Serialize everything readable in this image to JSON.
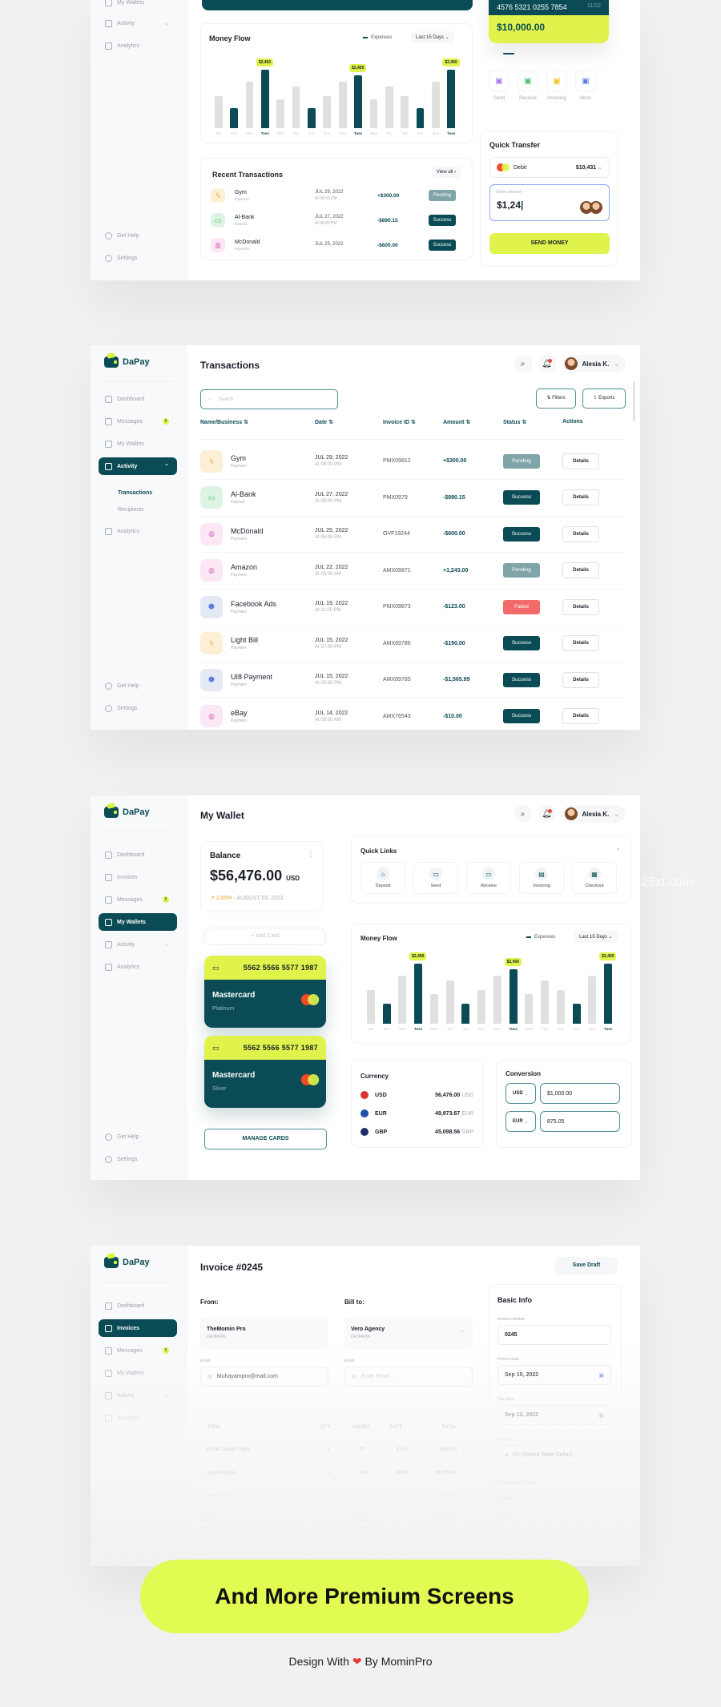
{
  "brand": {
    "name": "DaPay",
    "primary": "#0a4b55",
    "accent": "#dff34c",
    "danger": "#f26a6a"
  },
  "user": {
    "name": "Alesia K."
  },
  "screen1": {
    "sidebar": {
      "items": [
        {
          "label": "My Wallets"
        },
        {
          "label": "Activity"
        },
        {
          "label": "Analytics"
        }
      ],
      "footer": [
        {
          "label": "Get Help"
        },
        {
          "label": "Settings"
        }
      ]
    },
    "card": {
      "number": "4576 5321 0255 7854",
      "expiry": "11/22",
      "balance": "$10,000.00"
    },
    "actions": [
      {
        "label": "Send"
      },
      {
        "label": "Receive"
      },
      {
        "label": "Invoicing"
      },
      {
        "label": "More"
      }
    ],
    "money_flow": {
      "title": "Money Flow",
      "legend": "Expenses",
      "range": "Last 15 Days"
    },
    "quick_transfer": {
      "title": "Quick Transfer",
      "source": "Debit",
      "source_balance": "$10,431",
      "amount_label": "Enter amount",
      "amount_value": "$1,24",
      "send_label": "SEND MONEY"
    },
    "recent": {
      "title": "Recent Transactions",
      "view_all": "View all",
      "rows": [
        {
          "name": "Gym",
          "type": "Payment",
          "date": "JUL 29, 2022",
          "time": "At 08:00 PM",
          "amount": "+$300.00",
          "status": "Pending"
        },
        {
          "name": "Al-Bank",
          "type": "Deposit",
          "date": "JUL 27, 2022",
          "time": "At 09:00 PM",
          "amount": "-$890.15",
          "status": "Success"
        },
        {
          "name": "McDonald",
          "type": "Payment",
          "date": "JUL 25, 2022",
          "time": "",
          "amount": "-$600.00",
          "status": "Success"
        }
      ]
    }
  },
  "screen2": {
    "title": "Transactions",
    "sidebar": {
      "items": [
        {
          "label": "Dashboard"
        },
        {
          "label": "Messages",
          "badge": "5"
        },
        {
          "label": "My Wallets"
        },
        {
          "label": "Activity"
        },
        {
          "label": "Analytics"
        }
      ],
      "sub": [
        {
          "label": "Transactions"
        },
        {
          "label": "Recipients"
        }
      ],
      "footer": [
        {
          "label": "Get Help"
        },
        {
          "label": "Settings"
        }
      ]
    },
    "search_placeholder": "Search",
    "filters_label": "Filters",
    "exports_label": "Exports",
    "columns": [
      "Name/Business",
      "Date",
      "Invoice ID",
      "Amount",
      "Status",
      "Actions"
    ],
    "details_label": "Details",
    "rows": [
      {
        "name": "Gym",
        "type": "Payment",
        "date": "JUL 29, 2022",
        "time": "At 08:00 PM",
        "invoice": "PMX09812",
        "amount": "+$300.00",
        "status": "Pending",
        "icon": "bolt"
      },
      {
        "name": "Al-Bank",
        "type": "Deposit",
        "date": "JUL 27, 2022",
        "time": "At 09:00 PM",
        "invoice": "PMX0979",
        "amount": "-$890.15",
        "status": "Success",
        "icon": "cash"
      },
      {
        "name": "McDonald",
        "type": "Payment",
        "date": "JUL 25, 2022",
        "time": "At 05:00 PM",
        "invoice": "OVF19244",
        "amount": "-$600.00",
        "status": "Success",
        "icon": "bag"
      },
      {
        "name": "Amazon",
        "type": "Payment",
        "date": "JUL 22, 2022",
        "time": "At 08:00 AM",
        "invoice": "AMX09871",
        "amount": "+1,243.00",
        "status": "Pending",
        "icon": "bag"
      },
      {
        "name": "Facebook Ads",
        "type": "Payment",
        "date": "JUL 19, 2022",
        "time": "At 11:00 PM",
        "invoice": "PMX09873",
        "amount": "-$123.00",
        "status": "Failed",
        "icon": "hex"
      },
      {
        "name": "Light Bill",
        "type": "Payment",
        "date": "JUL 15, 2022",
        "time": "At 07:00 PM",
        "invoice": "AMX89786",
        "amount": "-$190.00",
        "status": "Success",
        "icon": "bolt"
      },
      {
        "name": "UI8 Payment",
        "type": "Payment",
        "date": "JUL 15, 2022",
        "time": "At 05:00 PM",
        "invoice": "AMX89785",
        "amount": "-$1,565.99",
        "status": "Success",
        "icon": "hex"
      },
      {
        "name": "eBay",
        "type": "Payment",
        "date": "JUL 14, 2022",
        "time": "At 09:00 AM",
        "invoice": "AMX76543",
        "amount": "-$10.00",
        "status": "Success",
        "icon": "bag"
      }
    ]
  },
  "screen3": {
    "title": "My Wallet",
    "sidebar": {
      "items": [
        {
          "label": "Dashboard"
        },
        {
          "label": "Invoices"
        },
        {
          "label": "Messages",
          "badge": "5"
        },
        {
          "label": "My Wallets"
        },
        {
          "label": "Activity"
        },
        {
          "label": "Analytics"
        }
      ],
      "footer": [
        {
          "label": "Get Help"
        },
        {
          "label": "Settings"
        }
      ]
    },
    "balance": {
      "title": "Balance",
      "amount": "$56,476.00",
      "currency": "USD",
      "change": "2.05%",
      "date": "AUGUST 03, 2022"
    },
    "add_card": "+ Add Card",
    "cards": [
      {
        "number": "5562 5566 5577 1987",
        "brand": "Mastercard",
        "tier": "Platinum"
      },
      {
        "number": "5562 5566 5577 1987",
        "brand": "Mastercard",
        "tier": "Silver"
      }
    ],
    "manage_cards": "MANAGE CARDS",
    "quick_links": {
      "title": "Quick Links",
      "items": [
        {
          "label": "Deposit"
        },
        {
          "label": "Send"
        },
        {
          "label": "Receive"
        },
        {
          "label": "Invoicing"
        },
        {
          "label": "Checkout"
        }
      ]
    },
    "money_flow": {
      "title": "Money Flow",
      "legend": "Expenses",
      "range": "Last 15 Days"
    },
    "currency": {
      "title": "Currency",
      "rows": [
        {
          "code": "USD",
          "amount": "56,476.00",
          "unit": "USD"
        },
        {
          "code": "EUR",
          "amount": "49,973.67",
          "unit": "EUR"
        },
        {
          "code": "GBP",
          "amount": "45,098.56",
          "unit": "GBP"
        }
      ]
    },
    "conversion": {
      "title": "Conversion",
      "from_currency": "USD",
      "from_amount": "$1,000.00",
      "to_currency": "EUR",
      "to_amount": "875.05"
    }
  },
  "screen4": {
    "title": "Invoice #0245",
    "save_draft": "Save Draft",
    "sidebar": {
      "items": [
        {
          "label": "Dashboard"
        },
        {
          "label": "Invoices"
        },
        {
          "label": "Messages",
          "badge": "5"
        },
        {
          "label": "My Wallets"
        },
        {
          "label": "Activity"
        },
        {
          "label": "Analytics"
        }
      ]
    },
    "from": {
      "label": "From:",
      "name": "TheMomin Pro",
      "id": "DA784166",
      "email_label": "Email",
      "email": "Muhayampro@mail.com"
    },
    "bill_to": {
      "label": "Bill to:",
      "name": "Vero Agency",
      "id": "DA784166",
      "email_label": "Email",
      "email_placeholder": "Enter Email ..."
    },
    "items": {
      "columns": [
        "ITEM",
        "QTY",
        "HOURS",
        "RATE",
        "TOTAL"
      ],
      "rows": [
        {
          "item": "Poster Design Prject",
          "qty": "1",
          "hours": "20",
          "rate": "$2.00",
          "total": "$500.00"
        },
        {
          "item": "Logo Designs",
          "qty": "5",
          "hours": "140",
          "rate": "$9.00",
          "total": "$8,789.00"
        },
        {
          "item": "Description",
          "qty": "0",
          "hours": "0",
          "rate": "0",
          "total": "$0.00"
        }
      ],
      "add_item": "Add Item",
      "subtotal_label": "Subtotal",
      "subtotal": "$8,856.00"
    },
    "basic_info": {
      "title": "Basic Info",
      "invoice_number_label": "Invoice number",
      "invoice_number": "0245",
      "invoice_date_label": "Invoice date",
      "invoice_date": "Sep 10, 2022",
      "due_date_label": "Due date",
      "due_date": "Sep 12, 2022",
      "currency_label": "Currency",
      "currency": "US (United State Dollar)",
      "payment_method": "Payment method",
      "late_fees": "Late fees",
      "notes": "Notes"
    }
  },
  "cta": {
    "label": "And More Premium Screens"
  },
  "credit": {
    "prefix": "Design With",
    "heart": "❤",
    "suffix": "By MominPro"
  },
  "watermark": "25xt.com",
  "chart_data": [
    {
      "type": "bar",
      "title": "Money Flow",
      "legend": [
        "Expenses"
      ],
      "categories": [
        "Sat",
        "Sun",
        "Mon",
        "Tues",
        "Wed",
        "Thu",
        "Sat",
        "Sun",
        "Mon",
        "Tues",
        "Wed",
        "Thu",
        "Sat",
        "Sun",
        "Mon",
        "Tues"
      ],
      "values": [
        1350,
        820,
        1950,
        2450,
        1200,
        1750,
        820,
        1350,
        1950,
        2200,
        1200,
        1750,
        1350,
        820,
        1950,
        2450
      ],
      "highlighted": [
        1,
        3,
        6,
        9,
        13,
        15
      ],
      "annotations": [
        {
          "index": 3,
          "label": "$2,450"
        },
        {
          "index": 9,
          "label": "$2,450"
        },
        {
          "index": 15,
          "label": "$2,450"
        }
      ],
      "ylim": [
        0,
        2600
      ]
    }
  ]
}
